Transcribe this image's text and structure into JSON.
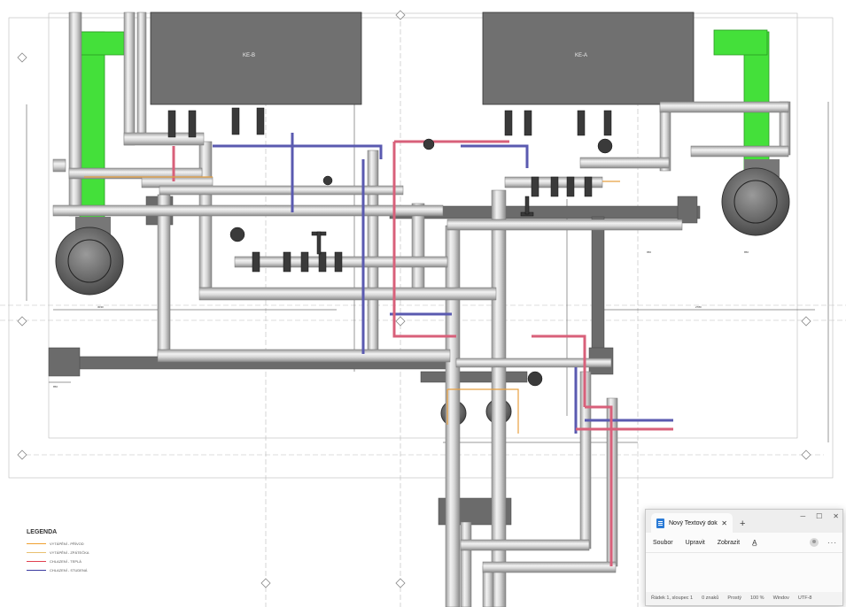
{
  "drawing": {
    "equipment_labels": [
      "KE-B",
      "KE-A"
    ]
  },
  "legend": {
    "title": "LEGENDA",
    "items": [
      {
        "label": "VYTÁPĚNÍ - PŘÍVOD",
        "color": "#f0a030"
      },
      {
        "label": "VYTÁPĚNÍ - ZPÁTEČKA",
        "color": "#e8c070"
      },
      {
        "label": "CHLAZENÍ - TEPLÁ",
        "color": "#e04050"
      },
      {
        "label": "CHLAZENÍ - STUDENÁ",
        "color": "#3a3aa0"
      }
    ]
  },
  "notepad": {
    "tab_title": "Nový Textový dok",
    "tab_close": "✕",
    "new_tab": "+",
    "window_minimize": "─",
    "window_maximize": "☐",
    "window_close": "✕",
    "menu": [
      "Soubor",
      "Upravit",
      "Zobrazit"
    ],
    "menu_icon": "A̲",
    "more": "···",
    "status": {
      "position": "Řádek 1, sloupec 1",
      "chars": "0 znaků",
      "mode": "Prostý",
      "zoom": "100 %",
      "line_ending": "Windov",
      "encoding": "UTF-8"
    }
  }
}
